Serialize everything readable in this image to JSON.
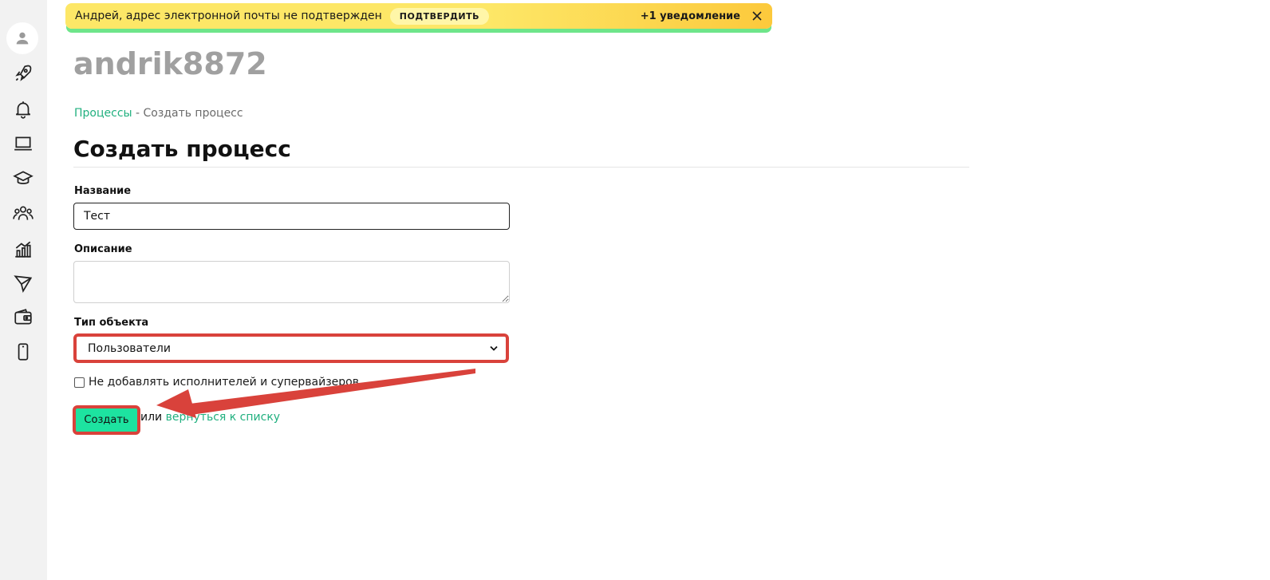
{
  "banner": {
    "message": "Андрей, адрес электронной почты не подтвержден",
    "confirm_label": "ПОДТВЕРДИТЬ",
    "notifications": "+1 уведомление"
  },
  "sidebar": {
    "icons": [
      "user-icon",
      "rocket-icon",
      "bell-icon",
      "laptop-icon",
      "graduation-cap-icon",
      "team-icon",
      "chart-icon",
      "send-icon",
      "wallet-icon",
      "phone-icon"
    ]
  },
  "header": {
    "username": "andrik8872"
  },
  "breadcrumb": {
    "parent": "Процессы",
    "separator": " - ",
    "current": "Создать процесс"
  },
  "page": {
    "title": "Создать процесс"
  },
  "form": {
    "name_label": "Название",
    "name_value": "Тест",
    "description_label": "Описание",
    "description_value": "",
    "object_type_label": "Тип объекта",
    "object_type_value": "Пользователи",
    "checkbox_label": "Не добавлять исполнителей и супервайзеров",
    "submit_label": "Создать",
    "or_text": "или",
    "back_link": "вернуться к списку"
  },
  "colors": {
    "accent": "#21b07f",
    "button": "#1de3a0",
    "highlight": "#d9423b",
    "banner": "#fde767"
  }
}
